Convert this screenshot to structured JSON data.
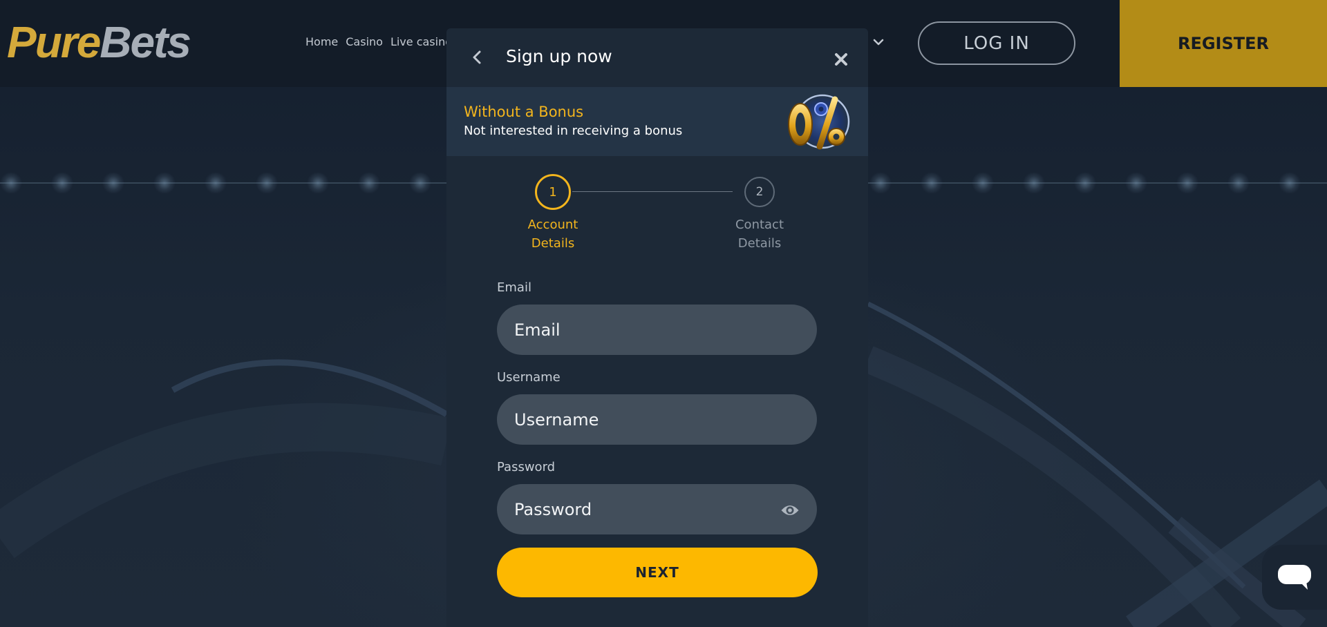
{
  "header": {
    "logo": {
      "part1": "Pure",
      "part2": "Bets"
    },
    "nav": [
      "Home",
      "Casino",
      "Live casino"
    ],
    "login_label": "LOG IN",
    "register_label": "REGISTER"
  },
  "modal": {
    "title": "Sign up now",
    "bonus": {
      "title": "Without a Bonus",
      "subtitle": "Not interested in receiving a bonus",
      "badge_text": "0%"
    },
    "steps": [
      {
        "number": "1",
        "label_line1": "Account",
        "label_line2": "Details",
        "state": "active"
      },
      {
        "number": "2",
        "label_line1": "Contact",
        "label_line2": "Details",
        "state": "inactive"
      }
    ],
    "fields": {
      "email": {
        "label": "Email",
        "placeholder": "Email",
        "value": ""
      },
      "username": {
        "label": "Username",
        "placeholder": "Username",
        "value": ""
      },
      "password": {
        "label": "Password",
        "placeholder": "Password",
        "value": ""
      }
    },
    "next_label": "NEXT"
  },
  "icons": {
    "back": "chevron-left-icon",
    "close": "close-icon",
    "eye": "eye-icon",
    "chat": "chat-icon",
    "nav_more": "chevron-down-icon"
  },
  "colors": {
    "accent": "#fdb800",
    "accent_text": "#f3b51d",
    "brand_gold": "#d4a93b",
    "register_bg": "#b38c17",
    "modal_bg": "#1d2937",
    "input_bg": "#424e5b"
  }
}
